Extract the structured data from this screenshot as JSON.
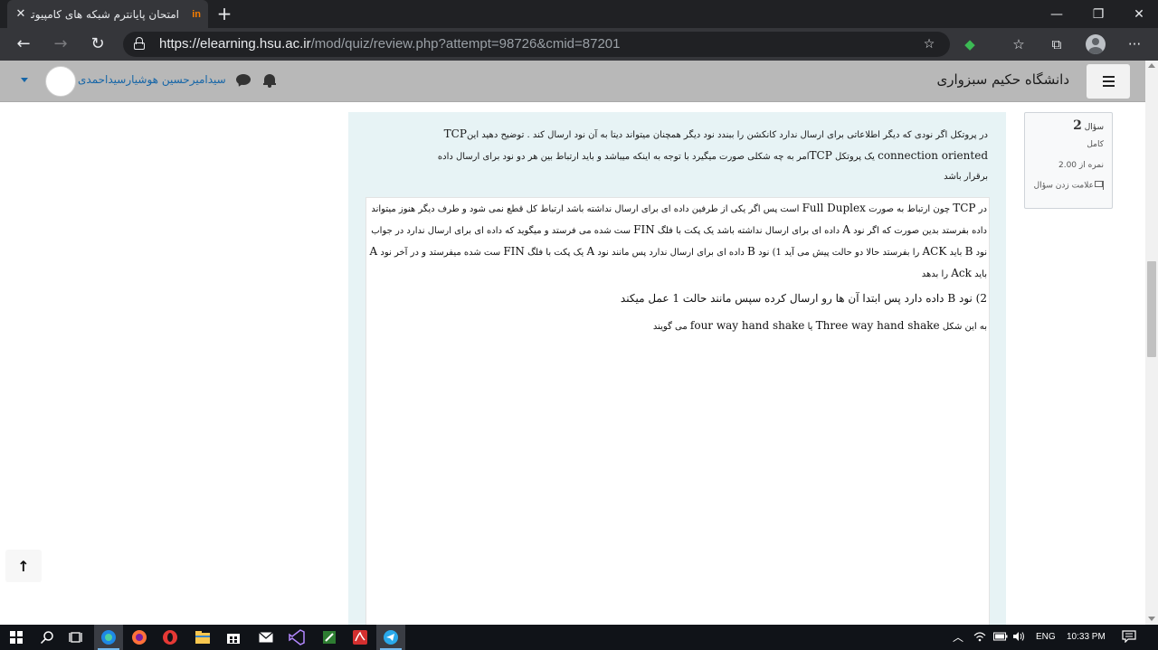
{
  "browser": {
    "tab": {
      "favicon_text": "in",
      "title": "امتحان پایانترم شبکه های کامپیوتری",
      "close": "✕"
    },
    "new_tab": "+",
    "window_controls": {
      "minimize": "—",
      "maximize": "❐",
      "close": "✕"
    },
    "url_host": "https://elearning.hsu.ac.ir",
    "url_path": "/mod/quiz/review.php?attempt=98726&cmid=87201",
    "nav": {
      "back": "←",
      "forward": "→",
      "reload": "↻"
    },
    "toolbar_icons": {
      "favorites_add": "☆",
      "extension": "◆",
      "favorites": "☆",
      "collections": "⧉",
      "more": "···"
    }
  },
  "navbar": {
    "site_name": "دانشگاه حکیم سبزواری",
    "user_name": "سیدامیرحسین هوشیارسیداحمدی"
  },
  "question_info": {
    "label": "سؤال",
    "number": "2",
    "state": "کامل",
    "grade": "نمره از 2.00",
    "flag": "علامت زدن سؤال"
  },
  "question": {
    "line1": "در پروتکل   اگر نودی که دیگر اطلاعاتی برای ارسال ندارد کانکشن را ببندد نود دیگر  همچنان میتواند دیتا به آن نود ارسال کند . توضیح دهید این",
    "line1_latin": "TCP",
    "line2_latin": "connection oriented",
    "line2": "یک پروتکل",
    "line2_latin2": "TCP",
    "line2b": "امر به چه شکلی صورت میگیرد با توجه به اینکه  میباشد و باید ارتباط بین هر دو نود برای ارسال داده",
    "line3": "برقرار باشد"
  },
  "answer": {
    "p1_a": "در",
    "p1_tcp": "TCP",
    "p1_b": "چون ارتباط به صورت",
    "p1_fd": "Full Duplex",
    "p1_c": "است پس اگر یکی از طرفین داده ای برای ارسال نداشته باشد ارتباط کل قطع نمی شود و طرف دیگر هنوز میتواند داده بفرستد بدین صورت که اگر نود",
    "p1_A": "A",
    "p1_d": "داده ای برای ارسال نداشته باشد یک پکت با فلگ",
    "p1_fin": "FIN",
    "p1_e": "ست شده می فرستد و میگوید که داده ای برای ارسال ندارد در جواب نود",
    "p1_B": "B",
    "p1_f": "باید",
    "p1_ack": "ACK",
    "p1_g": "را بفرستد حالا دو حالت پیش می آید 1) نود",
    "p1_B2": "B",
    "p1_h": "داده ای برای ارسال ندارد پس مانند نود",
    "p1_A2": "A",
    "p1_i": "یک پکت با فلگ",
    "p1_fin2": "FIN",
    "p1_j": "ست شده میفرستد و در آخر نود",
    "p1_A3": "A",
    "p1_k": "باید",
    "p1_ack2": "Ack",
    "p1_l": "را بدهد",
    "p2": "2) نود B داده دارد پس ابتدا آن ها رو ارسال کرده سپس مانند حالت 1 عمل میکند",
    "p3_a": "به این شکل",
    "p3_three": "Three way hand shake",
    "p3_b": "یا",
    "p3_four": "four way hand shake",
    "p3_c": "می گویند"
  },
  "back_to_top": "↑",
  "taskbar": {
    "language": "ENG",
    "time": "10:33 PM"
  },
  "colors": {
    "navbar_bg": "#b8b8b8",
    "formulation_bg": "#e7f3f5",
    "link": "#1565a7",
    "taskbar_bg": "#101318"
  }
}
